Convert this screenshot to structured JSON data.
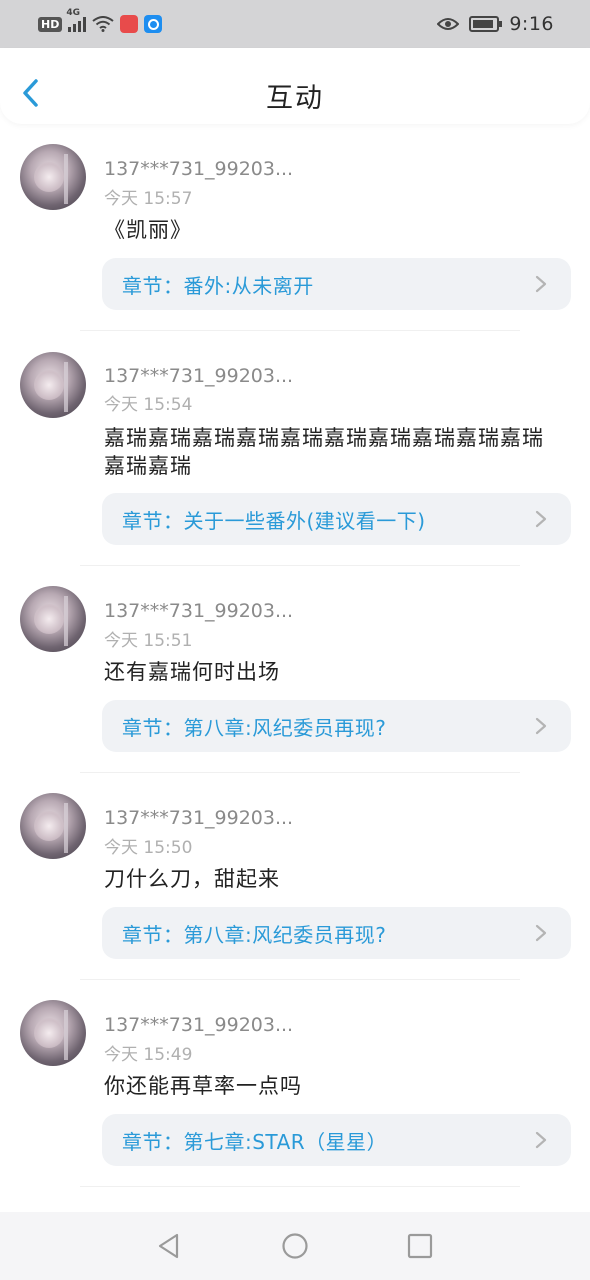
{
  "status_bar": {
    "hd": "HD",
    "network": "4G",
    "time": "9:16",
    "icons": [
      "hd-icon",
      "signal-icon",
      "wifi-icon",
      "app-notification-icon",
      "app-notification-icon",
      "eye-icon",
      "battery-icon"
    ]
  },
  "header": {
    "title": "互动",
    "back_icon": "chevron-left-icon"
  },
  "comments": [
    {
      "username": "137***731_99203...",
      "time": "今天 15:57",
      "content": "《凯丽》",
      "chapter": "章节：番外:从未离开"
    },
    {
      "username": "137***731_99203...",
      "time": "今天 15:54",
      "content": "嘉瑞嘉瑞嘉瑞嘉瑞嘉瑞嘉瑞嘉瑞嘉瑞嘉瑞嘉瑞嘉瑞嘉瑞",
      "chapter": "章节：关于一些番外(建议看一下)"
    },
    {
      "username": "137***731_99203...",
      "time": "今天 15:51",
      "content": "还有嘉瑞何时出场",
      "chapter": "章节：第八章:风纪委员再现?"
    },
    {
      "username": "137***731_99203...",
      "time": "今天 15:50",
      "content": "刀什么刀，甜起来",
      "chapter": "章节：第八章:风纪委员再现?"
    },
    {
      "username": "137***731_99203...",
      "time": "今天 15:49",
      "content": "你还能再草率一点吗",
      "chapter": "章节：第七章:STAR（星星）"
    }
  ],
  "nav_bar": {
    "icons": [
      "back-triangle-icon",
      "home-circle-icon",
      "recents-square-icon"
    ]
  },
  "colors": {
    "accent": "#2a9ad8",
    "status_bar_bg": "#d4d4d6",
    "chapter_bg": "#f0f2f5"
  }
}
